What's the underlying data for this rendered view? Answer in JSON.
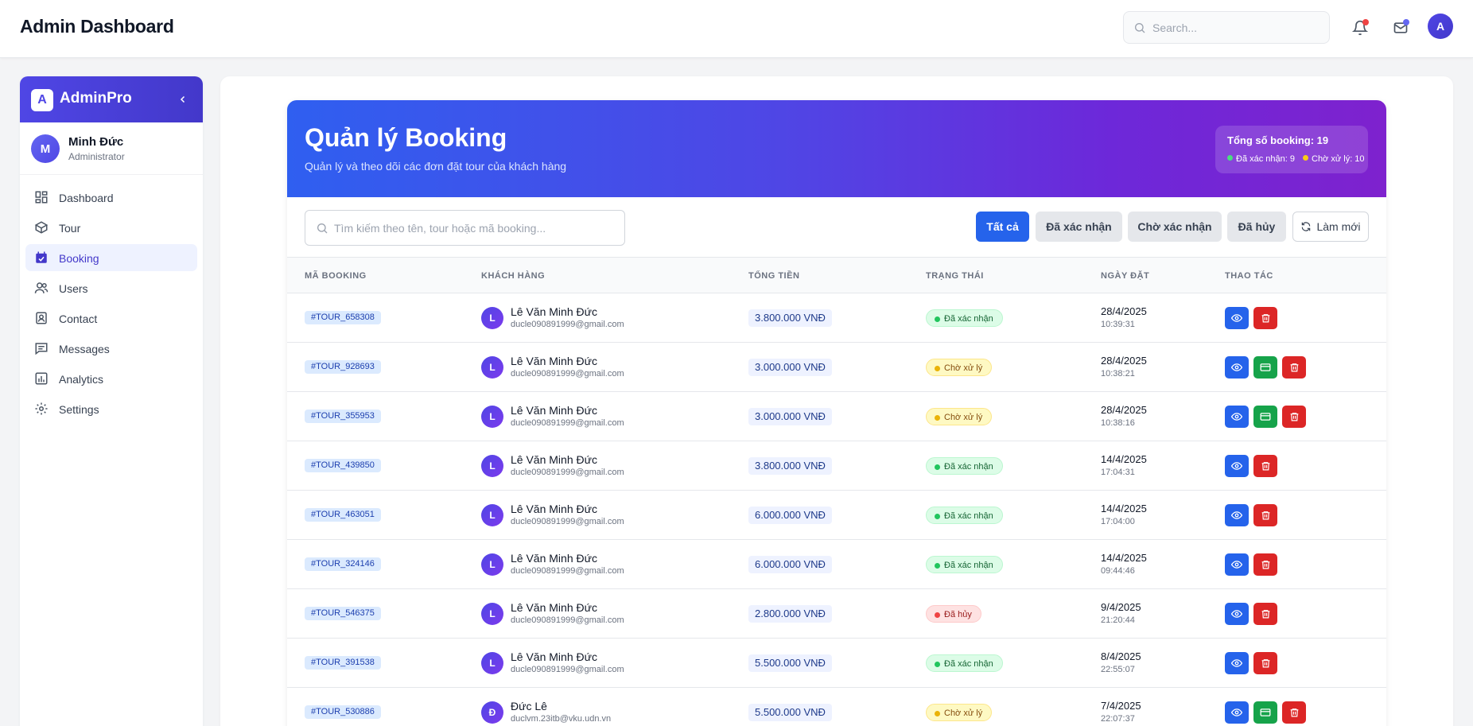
{
  "topbar": {
    "title": "Admin Dashboard",
    "search_placeholder": "Search...",
    "avatar_initial": "A",
    "notification_dot_color": "#ef4444",
    "mail_dot_color": "#6366f1"
  },
  "sidebar": {
    "brand_initial": "A",
    "brand_name": "AdminPro",
    "user": {
      "initial": "M",
      "name": "Minh Đức",
      "role": "Administrator"
    },
    "items": [
      {
        "label": "Dashboard",
        "icon": "grid-icon",
        "active": false
      },
      {
        "label": "Tour",
        "icon": "box-icon",
        "active": false
      },
      {
        "label": "Booking",
        "icon": "calendar-check-icon",
        "active": true
      },
      {
        "label": "Users",
        "icon": "users-icon",
        "active": false
      },
      {
        "label": "Contact",
        "icon": "contact-icon",
        "active": false
      },
      {
        "label": "Messages",
        "icon": "message-icon",
        "active": false
      },
      {
        "label": "Analytics",
        "icon": "analytics-icon",
        "active": false
      },
      {
        "label": "Settings",
        "icon": "gear-icon",
        "active": false
      }
    ]
  },
  "hero": {
    "title": "Quản lý Booking",
    "subtitle": "Quản lý và theo dõi các đơn đặt tour của khách hàng",
    "total_label": "Tổng số booking: 19",
    "confirmed_label": "Đã xác nhận: 9",
    "pending_label": "Chờ xử lý: 10"
  },
  "toolbar": {
    "search_placeholder": "Tìm kiếm theo tên, tour hoặc mã booking...",
    "filters": [
      "Tất cả",
      "Đã xác nhận",
      "Chờ xác nhận",
      "Đã hủy"
    ],
    "active_filter": "Tất cả",
    "refresh_label": "Làm mới"
  },
  "table": {
    "headers": [
      "MÃ BOOKING",
      "KHÁCH HÀNG",
      "TỔNG TIỀN",
      "TRẠNG THÁI",
      "NGÀY ĐẶT",
      "THAO TÁC"
    ],
    "rows": [
      {
        "code": "#TOUR_658308",
        "initial": "L",
        "name": "Lê Văn Minh Đức",
        "email": "ducle090891999@gmail.com",
        "amount": "3.800.000 VNĐ",
        "status": "Đã xác nhận",
        "status_type": "confirmed",
        "date": "28/4/2025",
        "time": "10:39:31"
      },
      {
        "code": "#TOUR_928693",
        "initial": "L",
        "name": "Lê Văn Minh Đức",
        "email": "ducle090891999@gmail.com",
        "amount": "3.000.000 VNĐ",
        "status": "Chờ xử lý",
        "status_type": "pending",
        "date": "28/4/2025",
        "time": "10:38:21"
      },
      {
        "code": "#TOUR_355953",
        "initial": "L",
        "name": "Lê Văn Minh Đức",
        "email": "ducle090891999@gmail.com",
        "amount": "3.000.000 VNĐ",
        "status": "Chờ xử lý",
        "status_type": "pending",
        "date": "28/4/2025",
        "time": "10:38:16"
      },
      {
        "code": "#TOUR_439850",
        "initial": "L",
        "name": "Lê Văn Minh Đức",
        "email": "ducle090891999@gmail.com",
        "amount": "3.800.000 VNĐ",
        "status": "Đã xác nhận",
        "status_type": "confirmed",
        "date": "14/4/2025",
        "time": "17:04:31"
      },
      {
        "code": "#TOUR_463051",
        "initial": "L",
        "name": "Lê Văn Minh Đức",
        "email": "ducle090891999@gmail.com",
        "amount": "6.000.000 VNĐ",
        "status": "Đã xác nhận",
        "status_type": "confirmed",
        "date": "14/4/2025",
        "time": "17:04:00"
      },
      {
        "code": "#TOUR_324146",
        "initial": "L",
        "name": "Lê Văn Minh Đức",
        "email": "ducle090891999@gmail.com",
        "amount": "6.000.000 VNĐ",
        "status": "Đã xác nhận",
        "status_type": "confirmed",
        "date": "14/4/2025",
        "time": "09:44:46"
      },
      {
        "code": "#TOUR_546375",
        "initial": "L",
        "name": "Lê Văn Minh Đức",
        "email": "ducle090891999@gmail.com",
        "amount": "2.800.000 VNĐ",
        "status": "Đã hủy",
        "status_type": "cancelled",
        "date": "9/4/2025",
        "time": "21:20:44"
      },
      {
        "code": "#TOUR_391538",
        "initial": "L",
        "name": "Lê Văn Minh Đức",
        "email": "ducle090891999@gmail.com",
        "amount": "5.500.000 VNĐ",
        "status": "Đã xác nhận",
        "status_type": "confirmed",
        "date": "8/4/2025",
        "time": "22:55:07"
      },
      {
        "code": "#TOUR_530886",
        "initial": "Đ",
        "name": "Đức Lê",
        "email": "duclvm.23itb@vku.udn.vn",
        "amount": "5.500.000 VNĐ",
        "status": "Chờ xử lý",
        "status_type": "pending",
        "date": "7/4/2025",
        "time": "22:07:37"
      }
    ]
  }
}
